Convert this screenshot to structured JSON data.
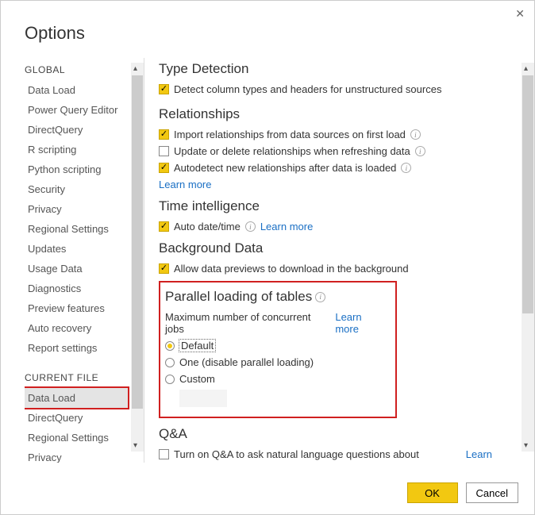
{
  "title": "Options",
  "sidebar": {
    "global_header": "GLOBAL",
    "global_items": [
      "Data Load",
      "Power Query Editor",
      "DirectQuery",
      "R scripting",
      "Python scripting",
      "Security",
      "Privacy",
      "Regional Settings",
      "Updates",
      "Usage Data",
      "Diagnostics",
      "Preview features",
      "Auto recovery",
      "Report settings"
    ],
    "current_header": "CURRENT FILE",
    "current_items": [
      "Data Load",
      "DirectQuery",
      "Regional Settings",
      "Privacy"
    ],
    "selected": "Data Load"
  },
  "main": {
    "type_detection": {
      "title": "Type Detection",
      "opt1": "Detect column types and headers for unstructured sources"
    },
    "relationships": {
      "title": "Relationships",
      "opt1": "Import relationships from data sources on first load",
      "opt2": "Update or delete relationships when refreshing data",
      "opt3": "Autodetect new relationships after data is loaded",
      "learn": "Learn more"
    },
    "time_intel": {
      "title": "Time intelligence",
      "opt1": "Auto date/time",
      "learn": "Learn more"
    },
    "background": {
      "title": "Background Data",
      "opt1": "Allow data previews to download in the background"
    },
    "parallel": {
      "title": "Parallel loading of tables",
      "sub": "Maximum number of concurrent jobs",
      "learn": "Learn more",
      "r1": "Default",
      "r2": "One (disable parallel loading)",
      "r3": "Custom"
    },
    "qna": {
      "title": "Q&A",
      "opt1": "Turn on Q&A to ask natural language questions about",
      "learn": "Learn"
    }
  },
  "buttons": {
    "ok": "OK",
    "cancel": "Cancel"
  }
}
